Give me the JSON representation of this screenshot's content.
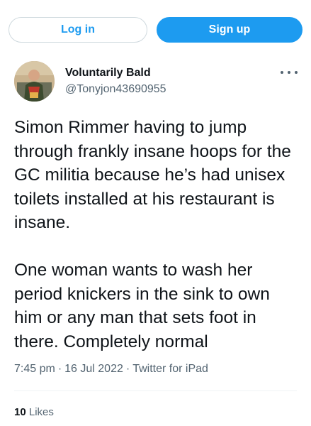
{
  "auth": {
    "login_label": "Log in",
    "signup_label": "Sign up"
  },
  "tweet": {
    "display_name": "Voluntarily Bald",
    "username": "@Tonyjon43690955",
    "text": "Simon Rimmer having to jump through frankly insane hoops for the GC militia because he’s had unisex toilets installed at his restaurant is insane.\n\nOne woman wants to wash her period knickers in the sink to own him or any man that sets foot in there. Completely normal",
    "time": "7:45 pm",
    "date": "16 Jul 2022",
    "source": "Twitter for iPad",
    "separator": "·",
    "likes_count": "10",
    "likes_label": "Likes"
  },
  "icons": {
    "more": "more-horizontal-icon",
    "avatar": "profile-photo"
  },
  "colors": {
    "accent": "#1d9bf0",
    "text_primary": "#0f1419",
    "text_secondary": "#536471",
    "border": "#cfd9de"
  }
}
